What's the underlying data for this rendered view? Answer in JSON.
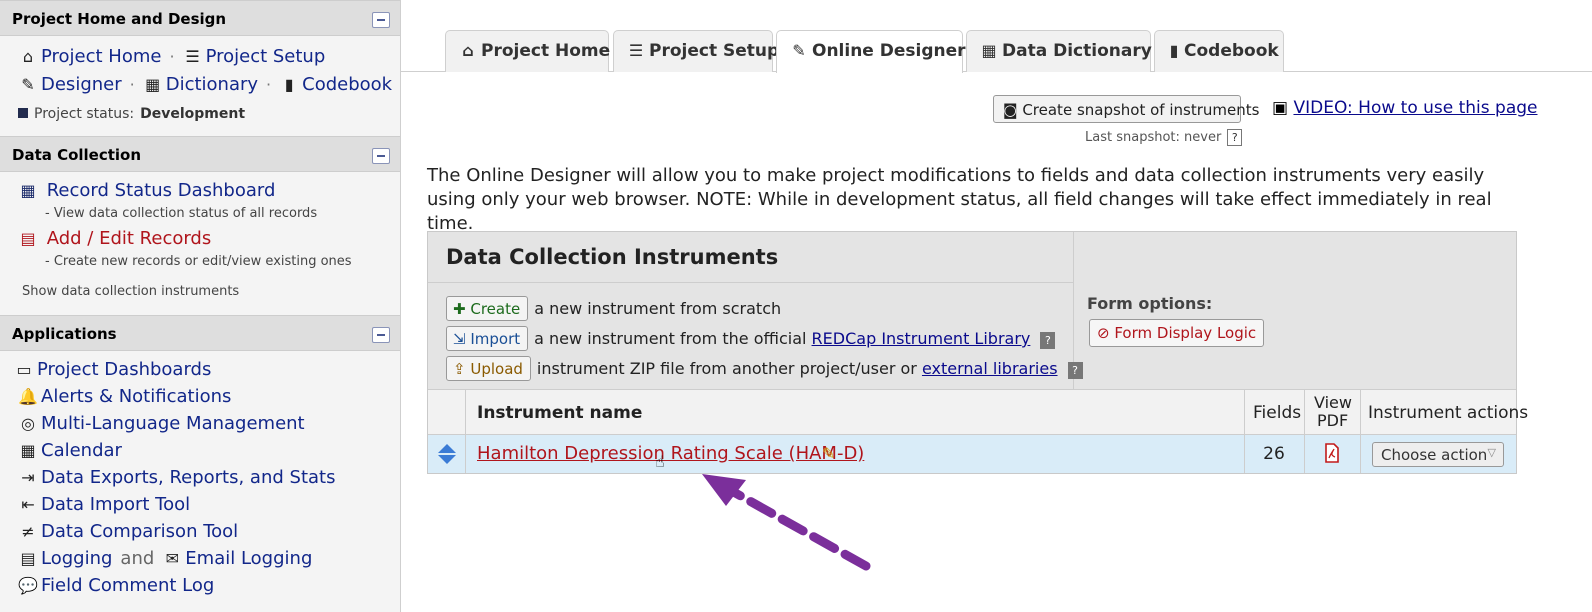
{
  "sidebar": {
    "section1": {
      "title": "Project Home and Design"
    },
    "project_home": "Project Home",
    "project_setup": "Project Setup",
    "designer": "Designer",
    "dictionary": "Dictionary",
    "codebook": "Codebook",
    "status_label": "Project status:",
    "status_value": "Development",
    "section2": {
      "title": "Data Collection"
    },
    "record_status": "Record Status Dashboard",
    "record_status_sub": "- View data collection status of all records",
    "add_edit": "Add / Edit Records",
    "add_edit_sub": "- Create new records or edit/view existing ones",
    "show_instruments": "Show data collection instruments",
    "section3": {
      "title": "Applications"
    },
    "apps": [
      "Project Dashboards",
      "Alerts & Notifications",
      "Multi-Language Management",
      "Calendar",
      "Data Exports, Reports, and Stats",
      "Data Import Tool",
      "Data Comparison Tool",
      "Logging",
      "and",
      "Email Logging",
      "Field Comment Log"
    ]
  },
  "tabs": [
    "Project Home",
    "Project Setup",
    "Online Designer",
    "Data Dictionary",
    "Codebook"
  ],
  "snapshot_button": "Create snapshot of instruments",
  "last_snapshot": "Last snapshot: never",
  "help_q": "?",
  "video_link": "VIDEO: How to use this page",
  "intro_text": "The Online Designer will allow you to make project modifications to fields and data collection instruments very easily using only your web browser. NOTE: While in development status, all field changes will take effect immediately in real time.",
  "dci": {
    "title": "Data Collection Instruments",
    "create_btn": "Create",
    "create_text": "a new instrument from scratch",
    "import_btn": "Import",
    "import_text": "a new instrument from the official",
    "import_link": "REDCap Instrument Library",
    "upload_btn": "Upload",
    "upload_text": "instrument ZIP file from another project/user or",
    "upload_link": "external libraries",
    "form_options": "Form options:",
    "form_display_logic": "Form Display Logic",
    "col_name": "Instrument name",
    "col_fields": "Fields",
    "col_pdf_1": "View",
    "col_pdf_2": "PDF",
    "col_actions": "Instrument actions",
    "row_name": "Hamilton Depression Rating Scale (HAM-D)",
    "row_fields": "26",
    "choose_action": "Choose action"
  },
  "colors": {
    "accent_purple": "#7b2f9b",
    "link_red": "#b0151c",
    "link_blue": "#0a0a8c"
  }
}
